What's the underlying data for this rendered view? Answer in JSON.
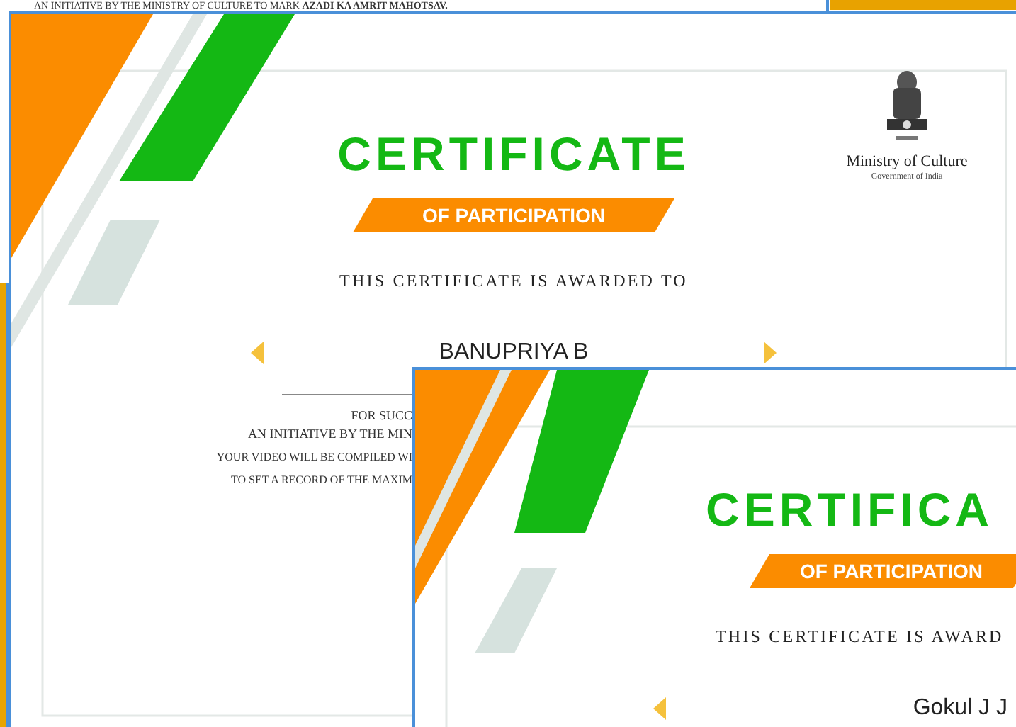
{
  "background_certificate": {
    "text": "AN INITIATIVE BY THE MINISTRY OF CULTURE TO MARK **AZADI KA AMRIT MAHOTSAV.**"
  },
  "certificates": [
    {
      "title": "CERTIFICATE",
      "ribbon": "OF PARTICIPATION",
      "awarded_to": "THIS CERTIFICATE IS AWARDED TO",
      "recipient": "BANUPRIYA B",
      "issuer": {
        "name": "Ministry of Culture",
        "subtitle": "Government of India"
      },
      "lines": [
        "FOR SUCC",
        "AN INITIATIVE BY THE MIN",
        "YOUR VIDEO WILL BE COMPILED WI",
        "TO SET A RECORD OF THE MAXIM"
      ]
    },
    {
      "title": "CERTIFICA",
      "ribbon": "OF PARTICIPATION",
      "awarded_to": "THIS CERTIFICATE IS AWARD",
      "recipient": "Gokul J J"
    }
  ]
}
